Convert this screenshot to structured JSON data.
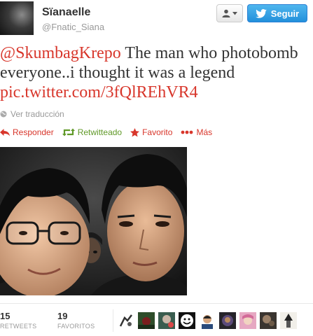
{
  "user": {
    "fullname": "Sïanaelle",
    "username": "@Fnatic_Siana"
  },
  "buttons": {
    "follow_label": "Seguir"
  },
  "tweet": {
    "mention": "@SkumbagKrepo",
    "text_line1_rest": " The man who photobomb",
    "text_line2": "everyone..i thought it was a legend",
    "link": "pic.twitter.com/3fQlREhVR4"
  },
  "translate_label": "Ver traducción",
  "actions": {
    "reply": "Responder",
    "retweet": "Retwitteado",
    "favorite": "Favorito",
    "more": "Más"
  },
  "stats": {
    "retweets_count": "15",
    "retweets_label": "RETWEETS",
    "favorites_count": "19",
    "favorites_label": "FAVORITOS"
  },
  "colors": {
    "link": "#d8362b",
    "retweeted": "#609928",
    "follow_button": "#2290db"
  },
  "icons": [
    "person-icon",
    "chevron-down-icon",
    "twitter-bird-icon",
    "globe-icon",
    "reply-icon",
    "retweet-icon",
    "star-icon",
    "more-dots-icon"
  ]
}
